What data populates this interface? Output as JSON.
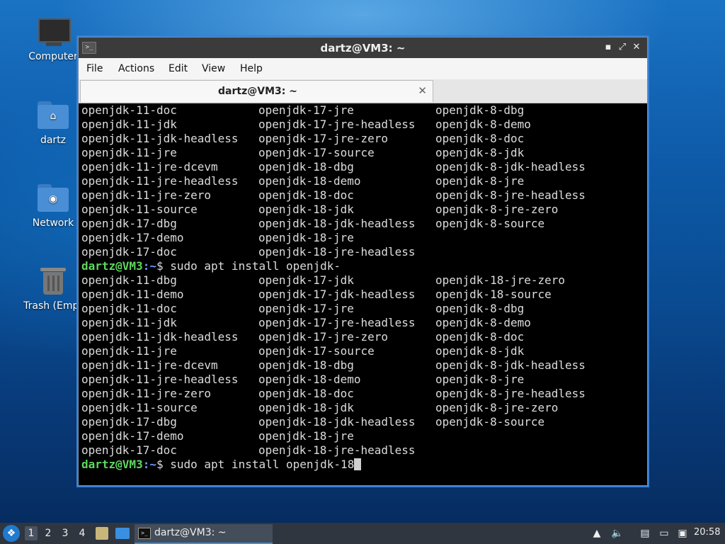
{
  "desktop": {
    "icons": [
      {
        "label": "Computer",
        "icon": "computer-icon"
      },
      {
        "label": "dartz",
        "icon": "home-folder-icon"
      },
      {
        "label": "Network",
        "icon": "network-folder-icon"
      },
      {
        "label": "Trash (Empt",
        "icon": "trash-icon"
      }
    ]
  },
  "window": {
    "title": "dartz@VM3: ~",
    "menu": [
      "File",
      "Actions",
      "Edit",
      "View",
      "Help"
    ],
    "tab_label": "dartz@VM3: ~"
  },
  "terminal": {
    "prompt_user": "dartz@VM3",
    "prompt_path": ":~",
    "prompt_symbol": "$ ",
    "lines": [
      [
        "openjdk-11-doc",
        "openjdk-17-jre",
        "openjdk-8-dbg"
      ],
      [
        "openjdk-11-jdk",
        "openjdk-17-jre-headless",
        "openjdk-8-demo"
      ],
      [
        "openjdk-11-jdk-headless",
        "openjdk-17-jre-zero",
        "openjdk-8-doc"
      ],
      [
        "openjdk-11-jre",
        "openjdk-17-source",
        "openjdk-8-jdk"
      ],
      [
        "openjdk-11-jre-dcevm",
        "openjdk-18-dbg",
        "openjdk-8-jdk-headless"
      ],
      [
        "openjdk-11-jre-headless",
        "openjdk-18-demo",
        "openjdk-8-jre"
      ],
      [
        "openjdk-11-jre-zero",
        "openjdk-18-doc",
        "openjdk-8-jre-headless"
      ],
      [
        "openjdk-11-source",
        "openjdk-18-jdk",
        "openjdk-8-jre-zero"
      ],
      [
        "openjdk-17-dbg",
        "openjdk-18-jdk-headless",
        "openjdk-8-source"
      ],
      [
        "openjdk-17-demo",
        "openjdk-18-jre",
        ""
      ],
      [
        "openjdk-17-doc",
        "openjdk-18-jre-headless",
        ""
      ],
      {
        "command": "sudo apt install openjdk-"
      },
      [
        "openjdk-11-dbg",
        "openjdk-17-jdk",
        "openjdk-18-jre-zero"
      ],
      [
        "openjdk-11-demo",
        "openjdk-17-jdk-headless",
        "openjdk-18-source"
      ],
      [
        "openjdk-11-doc",
        "openjdk-17-jre",
        "openjdk-8-dbg"
      ],
      [
        "openjdk-11-jdk",
        "openjdk-17-jre-headless",
        "openjdk-8-demo"
      ],
      [
        "openjdk-11-jdk-headless",
        "openjdk-17-jre-zero",
        "openjdk-8-doc"
      ],
      [
        "openjdk-11-jre",
        "openjdk-17-source",
        "openjdk-8-jdk"
      ],
      [
        "openjdk-11-jre-dcevm",
        "openjdk-18-dbg",
        "openjdk-8-jdk-headless"
      ],
      [
        "openjdk-11-jre-headless",
        "openjdk-18-demo",
        "openjdk-8-jre"
      ],
      [
        "openjdk-11-jre-zero",
        "openjdk-18-doc",
        "openjdk-8-jre-headless"
      ],
      [
        "openjdk-11-source",
        "openjdk-18-jdk",
        "openjdk-8-jre-zero"
      ],
      [
        "openjdk-17-dbg",
        "openjdk-18-jdk-headless",
        "openjdk-8-source"
      ],
      [
        "openjdk-17-demo",
        "openjdk-18-jre",
        ""
      ],
      [
        "openjdk-17-doc",
        "openjdk-18-jre-headless",
        ""
      ],
      {
        "command": "sudo apt install openjdk-18",
        "cursor": true
      }
    ]
  },
  "taskbar": {
    "workspaces": [
      "1",
      "2",
      "3",
      "4"
    ],
    "active_workspace": "1",
    "task_label": "dartz@VM3: ~",
    "clock": "20:58"
  },
  "colors": {
    "prompt_user": "#5fd75f",
    "prompt_path": "#6f9bff",
    "terminal_bg": "#000000",
    "terminal_fg": "#dcdcdc"
  }
}
